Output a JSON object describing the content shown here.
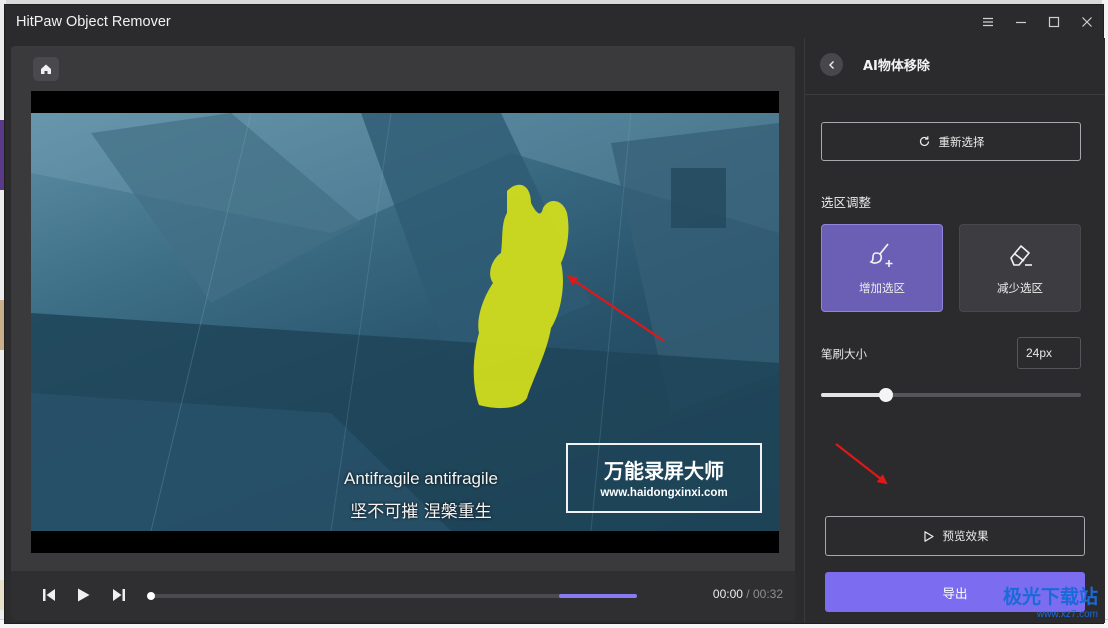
{
  "window": {
    "title": "HitPaw Object Remover"
  },
  "editor": {
    "caption_en": "Antifragile antifragile",
    "caption_zh": "坚不可摧 涅槃重生",
    "video_watermark_title": "万能录屏大师",
    "video_watermark_url": "www.haidongxinxi.com",
    "time_current": "00:00",
    "time_separator": "/",
    "time_total": "00:32",
    "timeline_selection": {
      "start": 0.84,
      "end": 1.0
    },
    "playhead": 0.0
  },
  "panel": {
    "title": "AI物体移除",
    "reselect_label": "重新选择",
    "selection_section": "选区调整",
    "add_selection": "增加选区",
    "reduce_selection": "减少选区",
    "brush_size_label": "笔刷大小",
    "brush_size_value": "24px",
    "brush_level": 0.25,
    "preview_label": "预览效果",
    "export_label": "导出"
  },
  "site_watermark": {
    "name": "极光下载站",
    "url": "www.xz7.com"
  },
  "colors": {
    "accent": "#7b6cf0",
    "active_tool": "#6b5fb5",
    "mask": "#d6e11b",
    "annotation_arrow": "#e01818"
  },
  "icons": [
    "home-icon",
    "menu-icon",
    "minimize-icon",
    "maximize-icon",
    "close-icon",
    "back-chevron-icon",
    "refresh-icon",
    "brush-plus-icon",
    "eraser-minus-icon",
    "play-outline-icon",
    "prev-frame-icon",
    "play-icon",
    "next-frame-icon"
  ]
}
